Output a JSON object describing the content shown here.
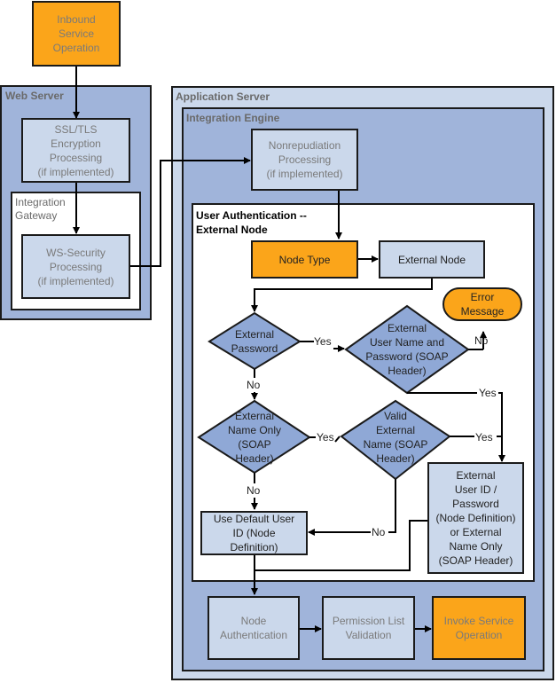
{
  "containers": {
    "web_server": "Web Server",
    "integration_gateway": "Integration\nGateway",
    "application_server": "Application Server",
    "integration_engine": "Integration Engine",
    "user_authentication": "User Authentication --\nExternal Node"
  },
  "nodes": {
    "inbound_service_operation": "Inbound\nService\nOperation",
    "ssl_tls": "SSL/TLS\nEncryption\nProcessing\n(if implemented)",
    "ws_security": "WS-Security\nProcessing\n(if implemented)",
    "nonrepudiation": "Nonrepudiation\nProcessing\n(if implemented)",
    "node_type": "Node Type",
    "external_node": "External Node",
    "error_message": "Error\nMessage",
    "external_password": "External\nPassword",
    "external_user_name_password": "External\nUser Name and\nPassword (SOAP\nHeader)",
    "external_name_only": "External\nName Only\n(SOAP\nHeader)",
    "valid_external_name": "Valid\nExternal\nName (SOAP\nHeader)",
    "external_user_id_password": "External\nUser ID /\nPassword\n(Node Definition)\nor External\nName Only\n(SOAP Header)",
    "use_default_user_id": "Use Default User\nID (Node\nDefinition)",
    "node_authentication": "Node\nAuthentication",
    "permission_list_validation": "Permission List\nValidation",
    "invoke_service_operation": "Invoke Service\nOperation"
  },
  "edge_labels": {
    "yes_1": "Yes",
    "no_1": "No",
    "no_error": "No",
    "yes_2": "Yes",
    "yes_3": "Yes",
    "yes_4": "Yes",
    "no_2": "No",
    "no_3": "No"
  },
  "colors": {
    "orange": "#fba51a",
    "light_blue": "#cbd8eb",
    "mid_blue": "#a0b4da",
    "diamond_blue": "#8fa8d6",
    "border": "#1a1a1a"
  }
}
